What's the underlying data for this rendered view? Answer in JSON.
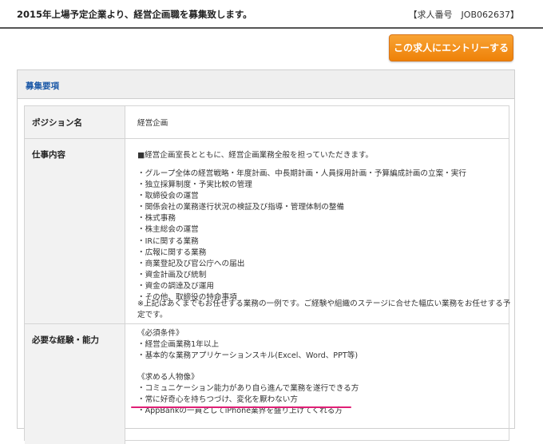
{
  "header": {
    "title": "2015年上場予定企業より、経営企画職を募集致します。",
    "job_number": "【求人番号　JOB062637】"
  },
  "entry_button": {
    "label": "この求人にエントリーする"
  },
  "section": {
    "title": "募集要項"
  },
  "rows": {
    "position": {
      "label": "ポジション名",
      "value": "経営企画"
    },
    "duties": {
      "label": "仕事内容",
      "intro": "■経営企画室長とともに、経営企画業務全般を担っていただきます。",
      "items": [
        "・グループ全体の経営戦略・年度計画、中長期計画・人員採用計画・予算編成計画の立案・実行",
        "・独立採算制度・予実比較の管理",
        "・取締役会の運営",
        "・関係会社の業務遂行状況の検証及び指導・管理体制の整備",
        "・株式事務",
        "・株主総会の運営",
        "・IRに関する業務",
        "・広報に関する業務",
        "・商業登記及び官公庁への届出",
        "・資金計画及び統制",
        "・資金の調達及び運用",
        "・その他、取締役の特命事項"
      ],
      "note": "※上記はあくまでもお任せする業務の一例です。ご経験や組織のステージに合せた幅広い業務をお任せする予定です。"
    },
    "requirements": {
      "label": "必要な経験・能力",
      "required_heading": "《必須条件》",
      "required_items": [
        "・経営企画業務1年以上",
        "・基本的な業務アプリケーションスキル(Excel、Word、PPT等)"
      ],
      "wanted_heading": "《求める人物像》",
      "wanted_items": [
        "・コミュニケーション能力があり自ら進んで業務を遂行できる方",
        "・常に好奇心を持ちつづけ、変化を厭わない方",
        "・AppBankの一員としてiPhone業界を盛り上げてくれる方"
      ]
    }
  },
  "colors": {
    "accent_orange": "#f39a22",
    "section_blue": "#1e5aa8",
    "underline_pink": "#e01f76"
  }
}
